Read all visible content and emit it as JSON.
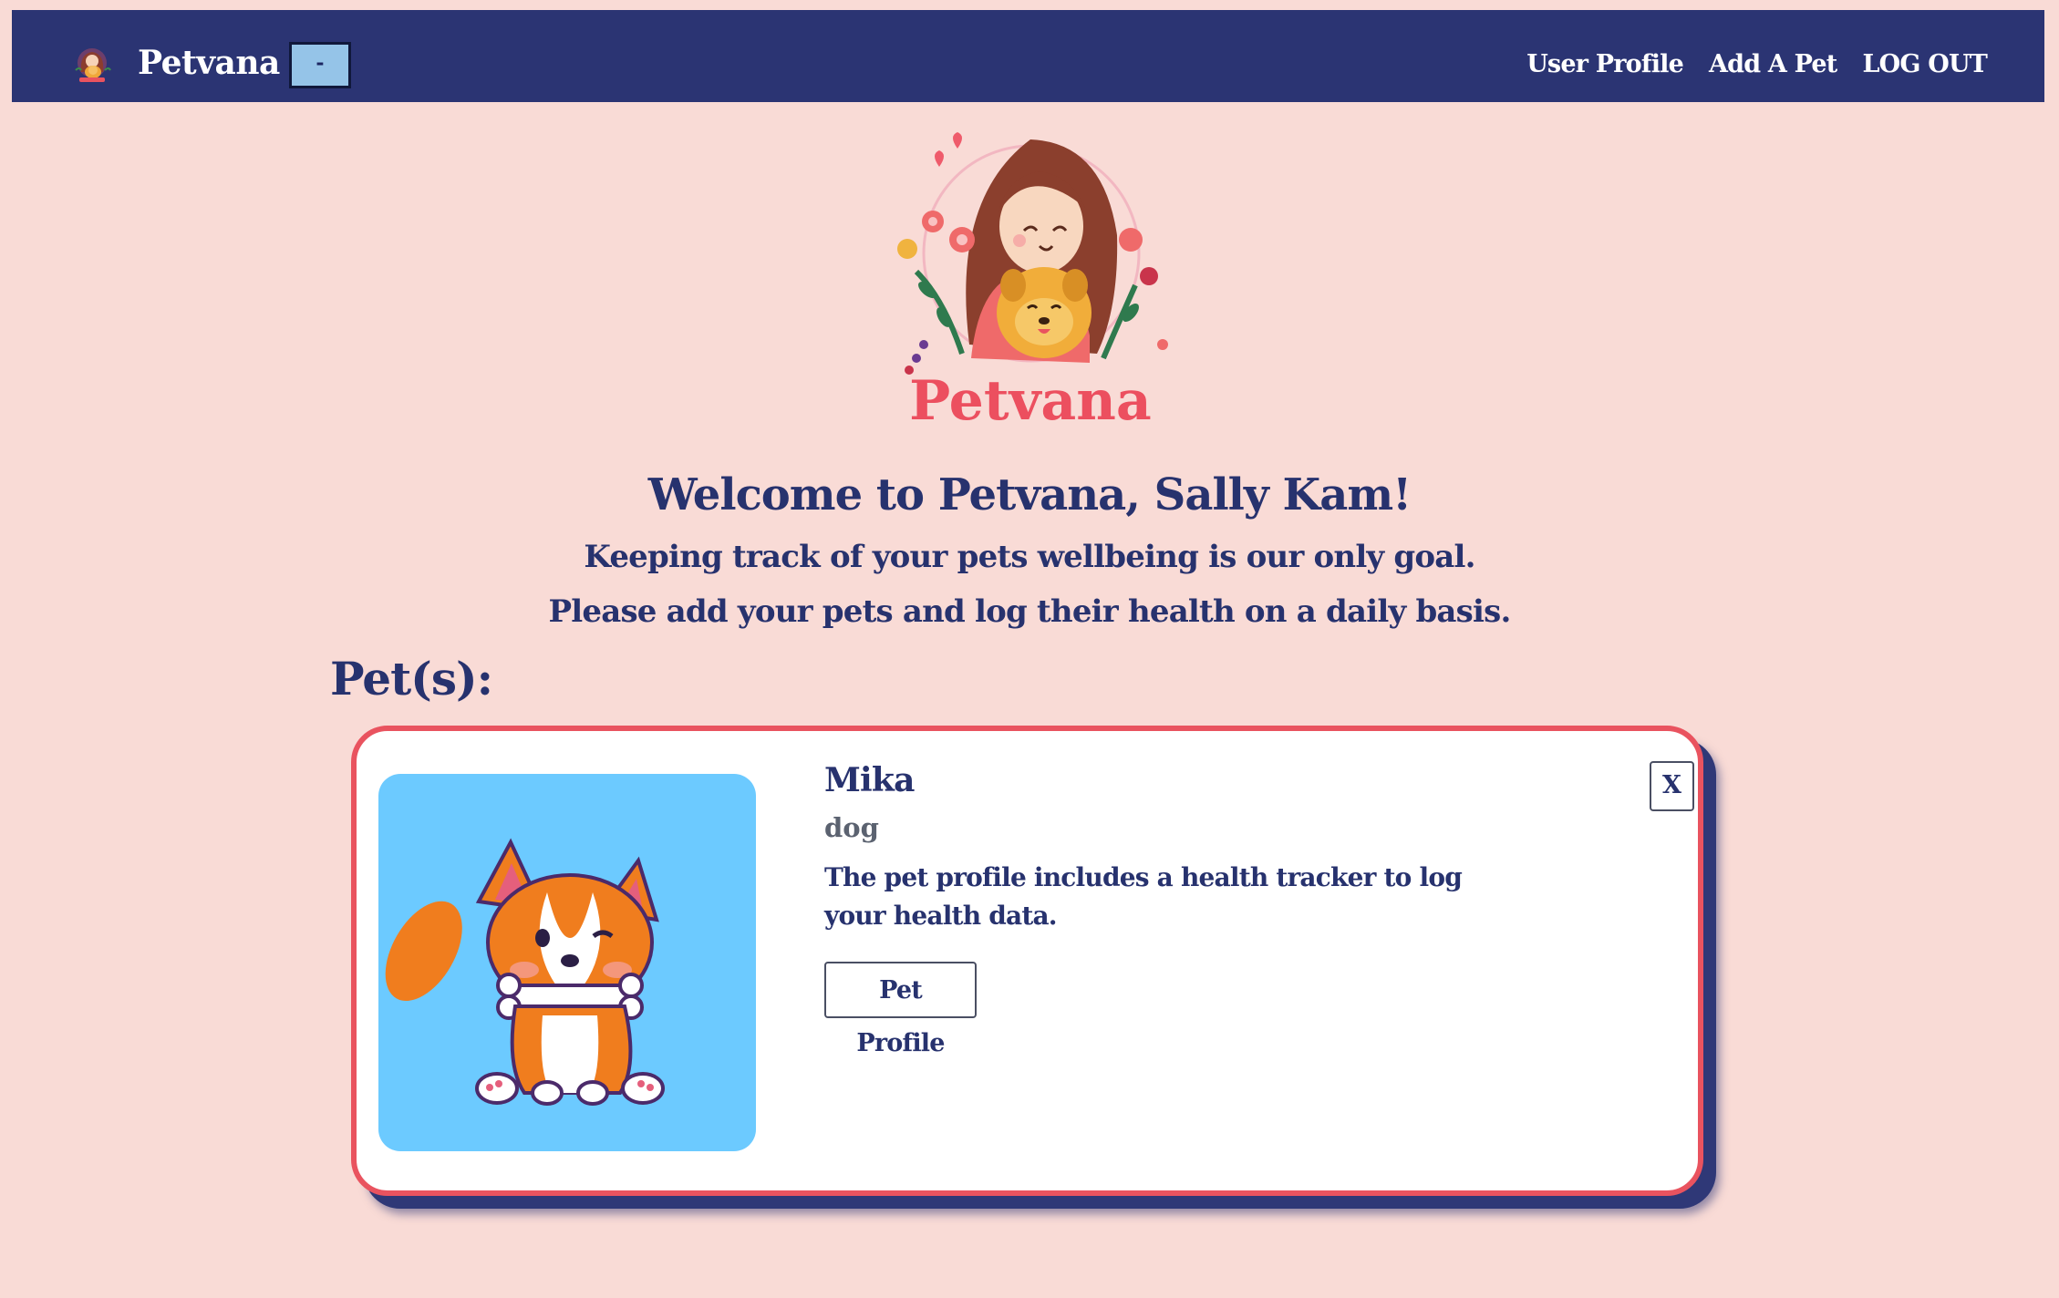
{
  "navbar": {
    "brand": "Petvana",
    "toggle_label": "-",
    "links": [
      "User Profile",
      "Add A Pet",
      "LOG OUT"
    ]
  },
  "hero": {
    "logo_text": "Petvana",
    "welcome": "Welcome to Petvana, Sally Kam!",
    "subline_1": "Keeping track of your pets wellbeing is our only goal.",
    "subline_2": "Please add your pets and log their health on a daily basis."
  },
  "pets_section": {
    "heading": "Pet(s):"
  },
  "pets": [
    {
      "name": "Mika",
      "species": "dog",
      "description": "The pet profile includes a health tracker to log your health data.",
      "profile_button": "Pet Profile",
      "close_button": "X",
      "image_icon": "corgi-illustration"
    }
  ],
  "colors": {
    "background": "#f9dbd6",
    "navbar": "#2b3473",
    "text": "#27326e",
    "card_border": "#e9535f",
    "pet_image_bg": "#6ccaff",
    "toggle_bg": "#95c4e8"
  }
}
